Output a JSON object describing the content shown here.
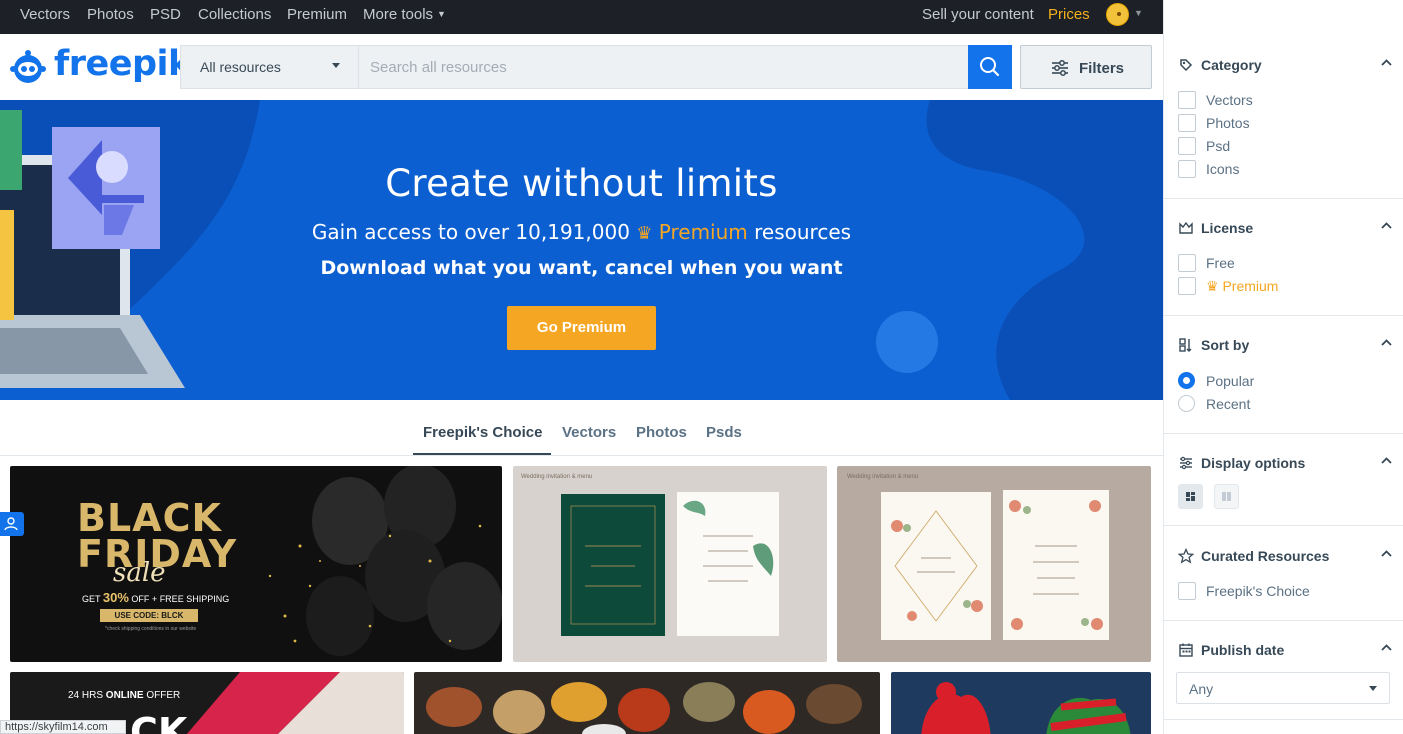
{
  "topnav": {
    "items": [
      "Vectors",
      "Photos",
      "PSD",
      "Collections",
      "Premium",
      "More tools"
    ],
    "sell": "Sell your content",
    "prices": "Prices"
  },
  "logo": {
    "text": "freepik"
  },
  "search": {
    "resource_select": "All resources",
    "placeholder": "Search all resources",
    "filters_label": "Filters"
  },
  "hero": {
    "title": "Create without limits",
    "subtitle_pre": "Gain access to over 10,191,000",
    "subtitle_premium": "Premium",
    "subtitle_post": "resources",
    "subtitle2": "Download what you want, cancel when you want",
    "cta": "Go Premium"
  },
  "tabs": [
    "Freepik's Choice",
    "Vectors",
    "Photos",
    "Psds"
  ],
  "tiles": {
    "black_friday": {
      "line1": "BLACK",
      "line2": "FRIDAY",
      "script": "sale",
      "offer_pre": "GET",
      "offer_pct": "30%",
      "offer_mid": "OFF +",
      "offer_ship": "FREE SHIPPING",
      "code": "USE CODE: BLCK",
      "note": "*check shipping conditions in our website"
    },
    "card1_caption": "Wedding invitation & menu",
    "card2_caption": "Wedding invitation & menu",
    "online_offer_pre": "24 HRS",
    "online_offer_bold": "ONLINE",
    "online_offer_post": "OFFER",
    "online_big": "CK"
  },
  "status_url": "https://skyfilm14.com",
  "panel": {
    "category": {
      "title": "Category",
      "options": [
        "Vectors",
        "Photos",
        "Psd",
        "Icons"
      ]
    },
    "license": {
      "title": "License",
      "options": [
        "Free",
        "Premium"
      ]
    },
    "sort": {
      "title": "Sort by",
      "options": [
        "Popular",
        "Recent"
      ],
      "selected": "Popular"
    },
    "display": {
      "title": "Display options"
    },
    "curated": {
      "title": "Curated Resources",
      "options": [
        "Freepik's Choice"
      ]
    },
    "publish": {
      "title": "Publish date",
      "value": "Any"
    }
  },
  "colors": {
    "brand": "#1273eb",
    "premium": "#f5a623",
    "nav": "#1d2127"
  }
}
